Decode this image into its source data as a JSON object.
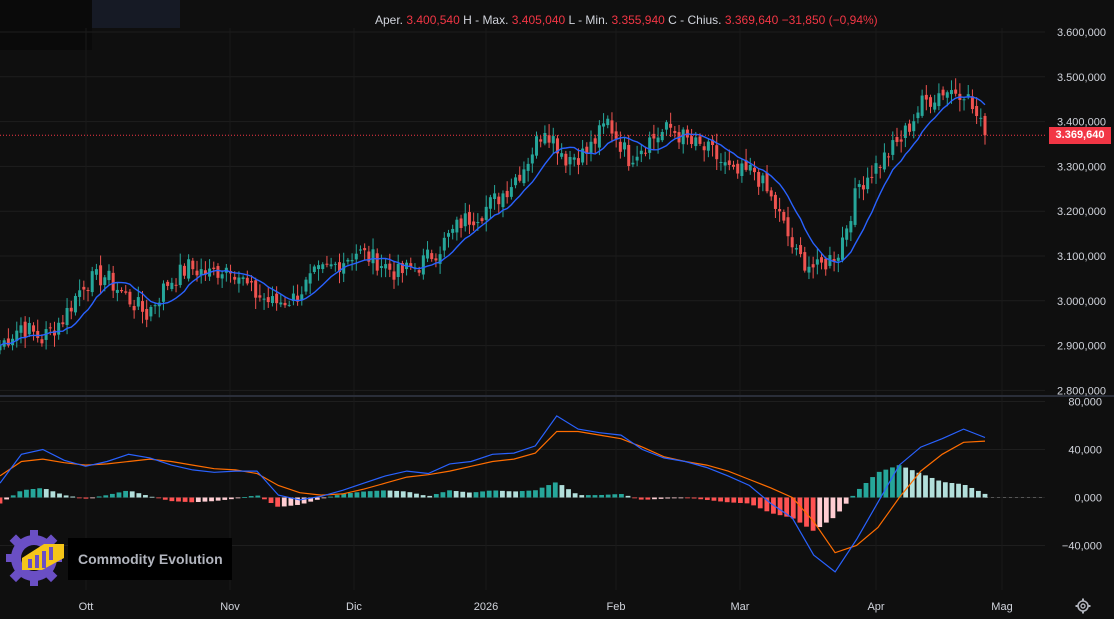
{
  "ohlc": {
    "open_label": "Aper.",
    "open": "3.400,540",
    "high_label": "H - Max.",
    "high": "3.405,040",
    "low_label": "L - Min.",
    "low": "3.355,940",
    "close_label": "C - Chius.",
    "close": "3.369,640",
    "change": "−31,850 (−0,94%)"
  },
  "last_price_tag": "3.369,640",
  "brand": {
    "name": "Commodity Evolution"
  },
  "icons": {
    "logo": "gear-chart-logo-icon",
    "settings": "gear-icon"
  },
  "colors": {
    "up": "#26a69a",
    "down": "#ef5350",
    "ma": "#2962ff",
    "macd": "#2962ff",
    "signal": "#ff6d00",
    "hist_up_strong": "#26a69a",
    "hist_up_weak": "#b2dfdb",
    "hist_down_strong": "#ff5252",
    "hist_down_weak": "#ffcdd2",
    "price_tag": "#f23645"
  },
  "chart_data": [
    {
      "type": "candlestick",
      "title": "",
      "x_tick_labels": [
        "Ott",
        "Nov",
        "Dic",
        "2026",
        "Feb",
        "Mar",
        "Apr",
        "Mag"
      ],
      "y_tick_labels": [
        "3.600,000",
        "3.500,000",
        "3.400,000",
        "3.300,000",
        "3.200,000",
        "3.100,000",
        "3.000,000",
        "2.900,000",
        "2.800,000"
      ],
      "ylim": [
        2800,
        3600
      ],
      "last_close": 3369.64,
      "grid": true,
      "note": "Daily candles with a short moving average line (blue)",
      "weekly_closes": [
        2900,
        2945,
        2915,
        2960,
        3040,
        3055,
        3010,
        2970,
        3040,
        3075,
        3060,
        3080,
        3020,
        2995,
        3005,
        3055,
        3080,
        3110,
        3090,
        3060,
        3080,
        3120,
        3175,
        3200,
        3240,
        3300,
        3390,
        3320,
        3330,
        3400,
        3320,
        3360,
        3385,
        3350,
        3330,
        3280,
        3290,
        3210,
        3100,
        3070,
        3110,
        3260,
        3310,
        3360,
        3440,
        3470,
        3470,
        3370
      ]
    },
    {
      "type": "line",
      "subtype": "macd",
      "y_tick_labels": [
        "80,000",
        "40,000",
        "0,000",
        "−40,000"
      ],
      "ylim": [
        -66,
        80
      ],
      "series": [
        {
          "name": "",
          "values": [
            12,
            36,
            40,
            31,
            26,
            30,
            36,
            33,
            27,
            23,
            21,
            22,
            22,
            2,
            -2,
            1,
            6,
            12,
            18,
            22,
            20,
            28,
            30,
            36,
            37,
            43,
            68,
            57,
            54,
            52,
            40,
            33,
            30,
            25,
            18,
            10,
            -5,
            -17,
            -48,
            -62,
            -35,
            -4,
            27,
            42,
            49,
            57,
            50
          ]
        },
        {
          "name": "",
          "values": [
            18,
            30,
            32,
            29,
            27,
            28,
            30,
            32,
            30,
            27,
            24,
            23,
            20,
            10,
            4,
            2,
            3,
            7,
            12,
            17,
            19,
            22,
            26,
            30,
            32,
            37,
            55,
            55,
            52,
            49,
            42,
            34,
            30,
            27,
            22,
            15,
            8,
            0,
            -20,
            -46,
            -40,
            -25,
            0,
            22,
            36,
            46,
            47
          ]
        }
      ],
      "histogram": [
        -5,
        6,
        8,
        2,
        -1,
        2,
        6,
        1,
        -3,
        -4,
        -3,
        -1,
        2,
        -8,
        -6,
        -1,
        3,
        5,
        6,
        5,
        1,
        6,
        4,
        6,
        5,
        6,
        13,
        2,
        2,
        3,
        -2,
        -1,
        0,
        -2,
        -4,
        -5,
        -13,
        -17,
        -28,
        -16,
        5,
        21,
        27,
        20,
        13,
        11,
        3
      ]
    }
  ]
}
